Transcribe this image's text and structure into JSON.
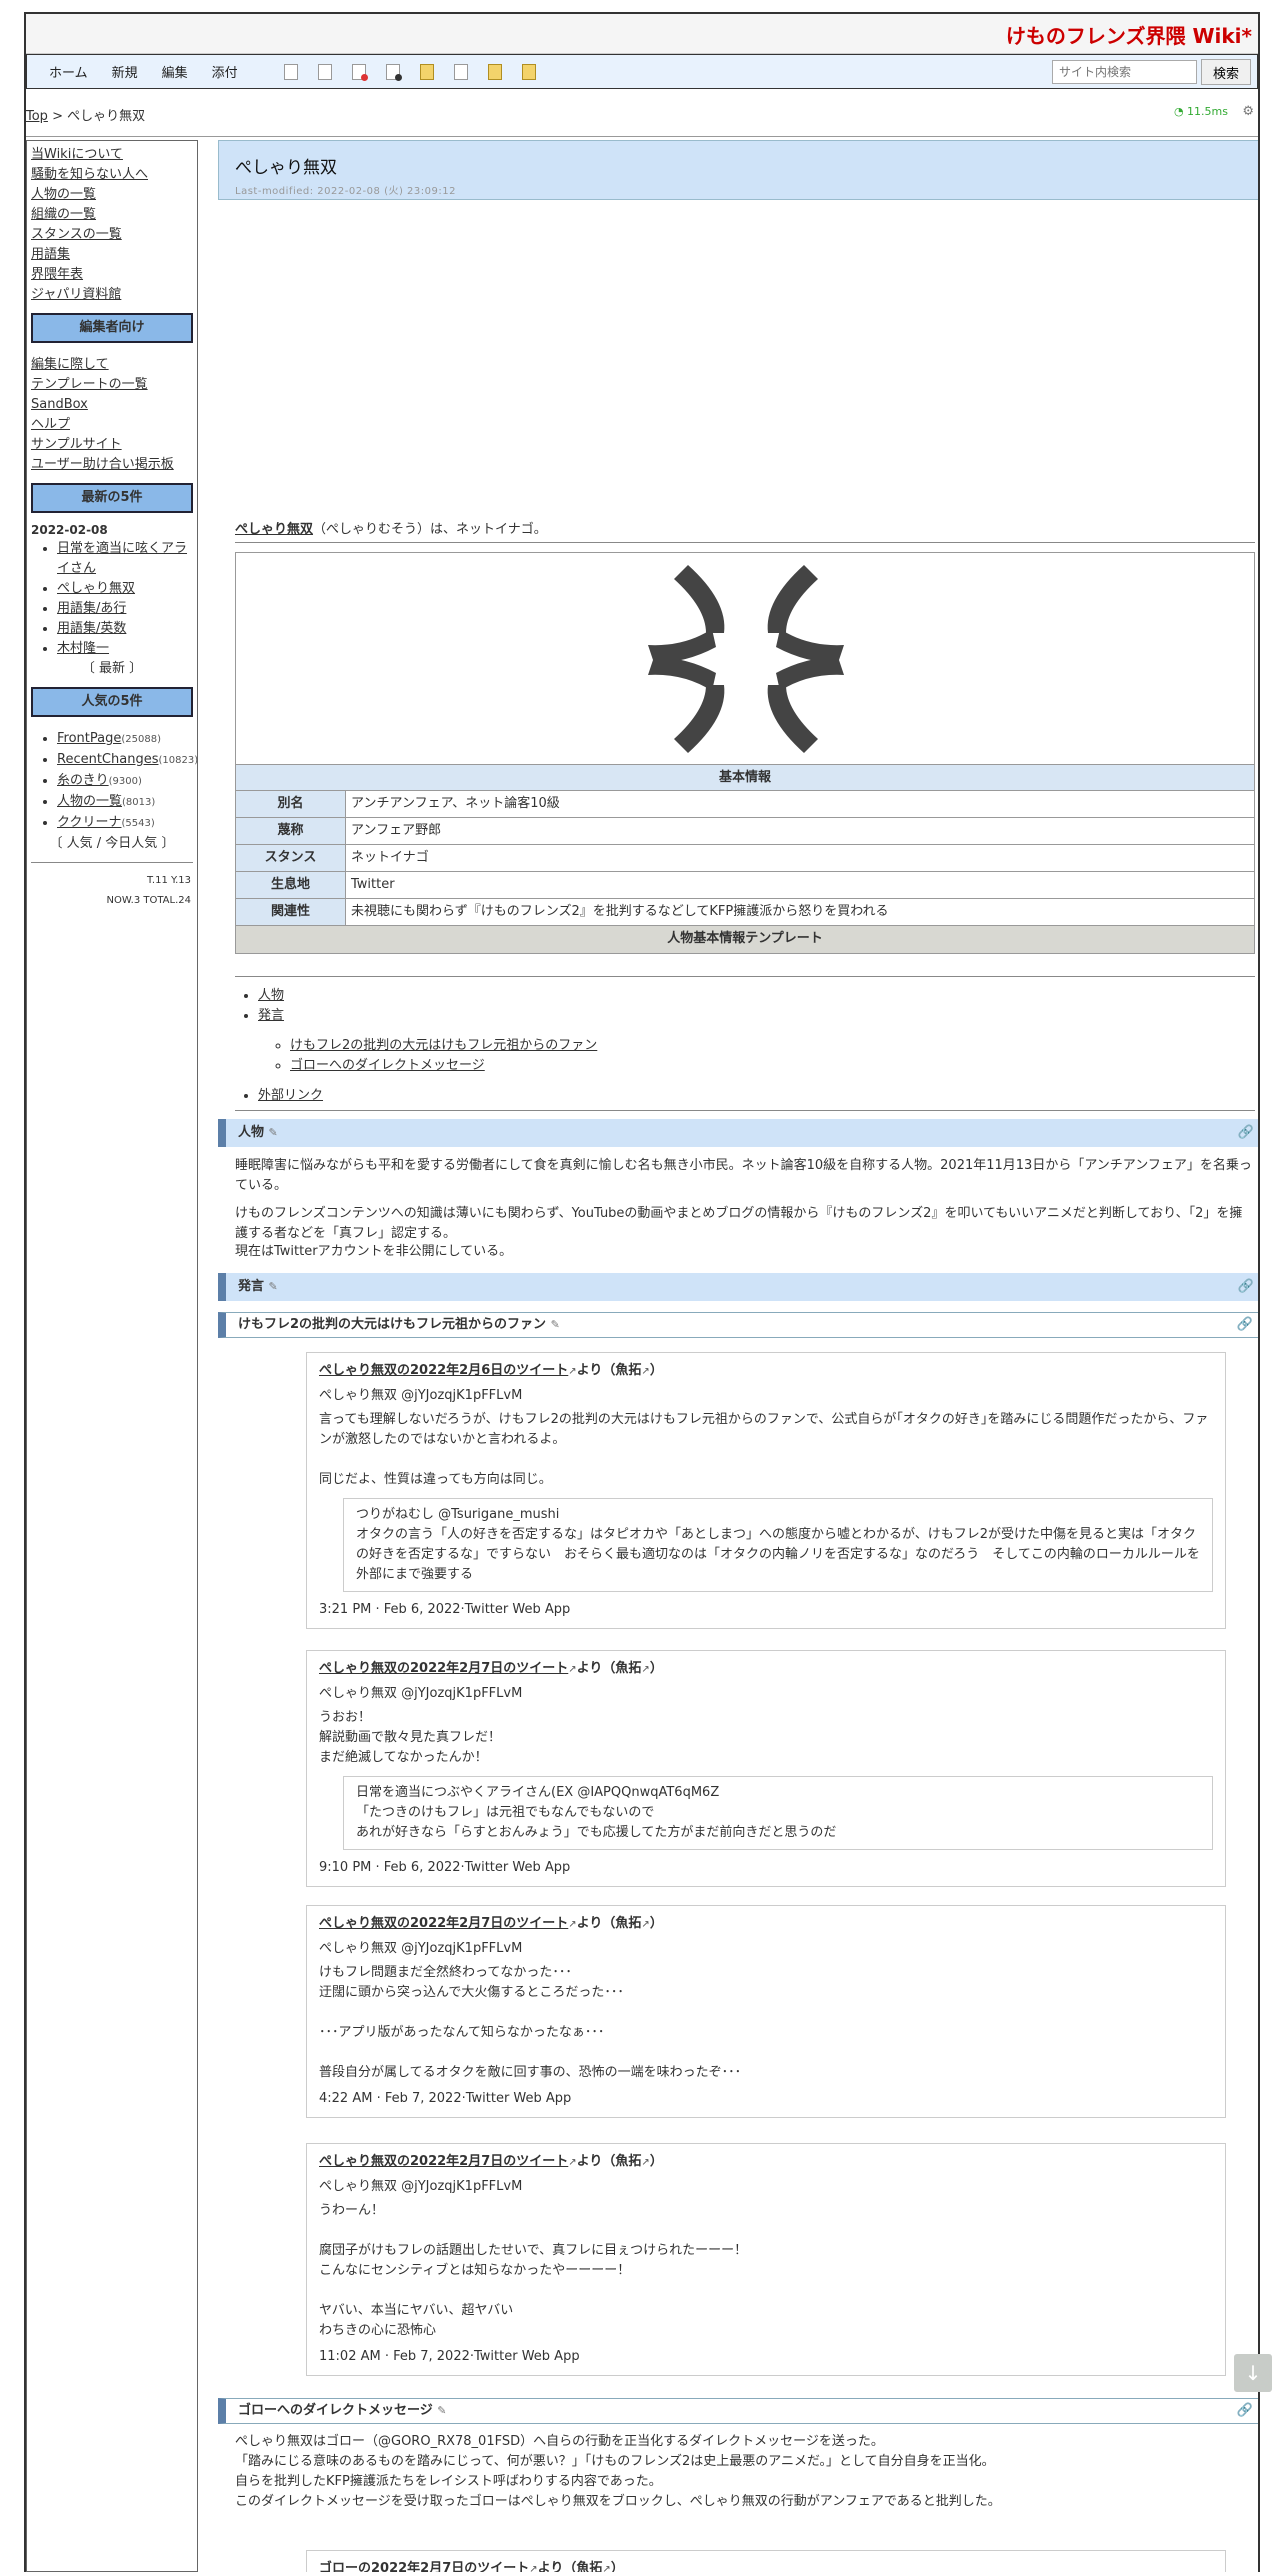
{
  "site": {
    "title": "けものフレンズ界隈 Wiki*"
  },
  "nav": {
    "home": "ホーム",
    "new": "新規",
    "edit": "編集",
    "attach": "添付",
    "search_placeholder": "サイト内検索",
    "search_btn": "検索"
  },
  "breadcrumb": {
    "top": "Top",
    "sep": " > ",
    "current": "ぺしゃり無双"
  },
  "timing": "11.5ms",
  "sidebar": {
    "links1": [
      "当Wikiについて",
      "騒動を知らない人へ",
      "人物の一覧",
      "組織の一覧",
      "スタンスの一覧",
      "用語集",
      "界隈年表",
      "ジャパリ資料館"
    ],
    "editors_head": "編集者向け",
    "links2": [
      "編集に際して",
      "テンプレートの一覧",
      "SandBox",
      "ヘルプ",
      "サンプルサイト",
      "ユーザー助け合い掲示板"
    ],
    "latest_head": "最新の5件",
    "latest_date": "2022-02-08",
    "latest": [
      "日常を適当に呟くアライさん",
      "ぺしゃり無双",
      "用語集/あ行",
      "用語集/英数",
      "木村隆一"
    ],
    "latest_more": "〔 最新 〕",
    "popular_head": "人気の5件",
    "popular": [
      {
        "name": "FrontPage",
        "count": "(25088)"
      },
      {
        "name": "RecentChanges",
        "count": "(10823)"
      },
      {
        "name": "糸のきり",
        "count": "(9300)"
      },
      {
        "name": "人物の一覧",
        "count": "(8013)"
      },
      {
        "name": "ククリーナ",
        "count": "(5543)"
      }
    ],
    "popular_more": "〔 人気 / 今日人気 〕",
    "stats1": "T.11 Y.13",
    "stats2": "NOW.3 TOTAL.24"
  },
  "page": {
    "title": "ぺしゃり無双",
    "modified": "Last-modified: 2022-02-08 (火) 23:09:12",
    "intro_name": "ぺしゃり無双",
    "intro_rest": "（ぺしゃりむそう）は、ネットイナゴ。"
  },
  "infobox": {
    "head": "基本情報",
    "rows": [
      {
        "k": "別名",
        "v": "アンチアンフェア、ネット論客10級"
      },
      {
        "k": "蔑称",
        "v": "アンフェア野郎"
      },
      {
        "k": "スタンス",
        "v": "ネットイナゴ"
      },
      {
        "k": "生息地",
        "v": "Twitter"
      },
      {
        "k": "関連性",
        "v": "未視聴にも関わらず『けものフレンズ2』を批判するなどしてKFP擁護派から怒りを買われる"
      }
    ],
    "foot": "人物基本情報テンプレート"
  },
  "toc": {
    "person": "人物",
    "remarks": "発言",
    "sub1": "けもフレ2の批判の大元はけもフレ元祖からのファン",
    "sub2": "ゴローへのダイレクトメッセージ",
    "external": "外部リンク"
  },
  "sections": {
    "person": {
      "head": "人物",
      "p1": "睡眠障害に悩みながらも平和を愛する労働者にして食を真剣に愉しむ名も無き小市民。ネット論客10級を自称する人物。2021年11月13日から「アンチアンフェア」を名乗っている。",
      "p2": "けものフレンズコンテンツへの知識は薄いにも関わらず、YouTubeの動画やまとめブログの情報から『けものフレンズ2』を叩いてもいいアニメだと判断しており、「2」を擁護する者などを「真フレ」認定する。",
      "p3": "現在はTwitterアカウントを非公開にしている。"
    },
    "remarks_head": "発言",
    "sub1_head": "けもフレ2の批判の大元はけもフレ元祖からのファン",
    "sub2_head": "ゴローへのダイレクトメッセージ",
    "sub2_body": "ぺしゃり無双はゴロー（@GORO_RX78_01FSD）へ自らの行動を正当化するダイレクトメッセージを送った。\n「踏みにじる意味のあるものを踏みにじって、何が悪い？」「けものフレンズ2は史上最悪のアニメだ。」として自分自身を正当化。\n自らを批判したKFP擁護派たちをレイシスト呼ばわりする内容であった。\nこのダイレクトメッセージを受け取ったゴローはぺしゃり無双をブロックし、ぺしゃり無双の行動がアンフェアであると批判した。"
  },
  "tweets": [
    {
      "title": "ぺしゃり無双の2022年2月6日のツイート",
      "from": "より（魚拓",
      "close": "）",
      "handle": "ぺしゃり無双 @jYJozqjK1pFFLvM",
      "body": "言っても理解しないだろうが、けもフレ2の批判の大元はけもフレ元祖からのファンで、公式自らが｢オタクの好き｣を踏みにじる問題作だったから、ファンが激怒したのではないかと言われるよ。\n\n同じだよ、性質は違っても方向は同じ。",
      "quote": "つりがねむし @Tsurigane_mushi\nオタクの言う「人の好きを否定するな」はタピオカや「あとしまつ」への態度から嘘とわかるが、けもフレ2が受けた中傷を見ると実は「オタクの好きを否定するな」ですらない　おそらく最も適切なのは「オタクの内輪ノリを否定するな」なのだろう　そしてこの内輪のローカルルールを外部にまで強要する",
      "meta": "3:21 PM · Feb 6, 2022·Twitter Web App"
    },
    {
      "title": "ぺしゃり無双の2022年2月7日のツイート",
      "from": "より（魚拓",
      "close": "）",
      "handle": "ぺしゃり無双 @jYJozqjK1pFFLvM",
      "body": "うおお！\n解説動画で散々見た真フレだ！\nまだ絶滅してなかったんか！",
      "quote": "日常を適当につぶやくアライさん(EX @IAPQQnwqAT6qM6Z\n「たつきのけもフレ」は元祖でもなんでもないので\nあれが好きなら「らすとおんみょう」でも応援してた方がまだ前向きだと思うのだ",
      "meta": "9:10 PM · Feb 6, 2022·Twitter Web App"
    },
    {
      "title": "ぺしゃり無双の2022年2月7日のツイート",
      "from": "より（魚拓",
      "close": "）",
      "handle": "ぺしゃり無双 @jYJozqjK1pFFLvM",
      "body": "けもフレ問題まだ全然終わってなかった･･･\n迂闊に頭から突っ込んで大火傷するところだった･･･\n\n･･･アプリ版があったなんて知らなかったなぁ･･･\n\n普段自分が属してるオタクを敵に回す事の、恐怖の一端を味わったぞ･･･",
      "quote": "",
      "meta": "4:22 AM · Feb 7, 2022·Twitter Web App"
    },
    {
      "title": "ぺしゃり無双の2022年2月7日のツイート",
      "from": "より（魚拓",
      "close": "）",
      "handle": "ぺしゃり無双 @jYJozqjK1pFFLvM",
      "body": "うわーん！\n\n腐団子がけもフレの話題出したせいで、真フレに目ぇつけられたーーー！\nこんなにセンシティブとは知らなかったやーーーー！\n\nヤバい、本当にヤバい、超ヤバい\nわちきの心に恐怖心",
      "quote": "",
      "meta": "11:02 AM · Feb 7, 2022·Twitter Web App"
    },
    {
      "title": "ゴローの2022年2月7日のツイート",
      "from": "より（魚拓",
      "close": "）",
      "handle": "",
      "body": "",
      "quote": "",
      "meta": ""
    }
  ]
}
